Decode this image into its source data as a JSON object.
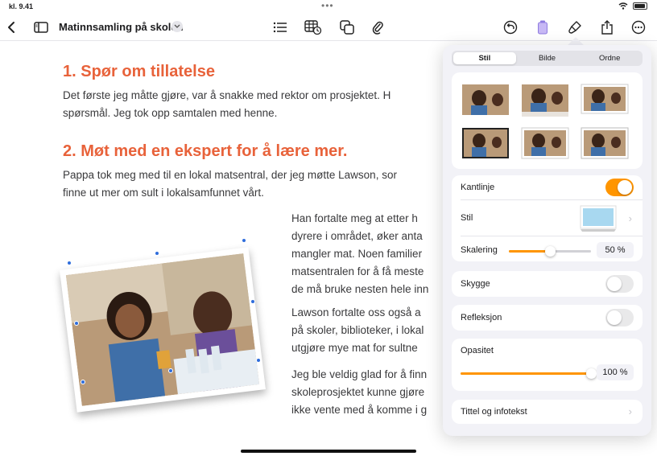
{
  "status": {
    "time": "kl. 9.41",
    "dots": "•••"
  },
  "toolbar": {
    "title": "Matinnsamling på skolen",
    "icons": [
      "back-icon",
      "sidebar-icon",
      "title-chevron-icon",
      "list-icon",
      "table-icon",
      "shapes-icon",
      "attachment-icon",
      "undo-icon",
      "document-icon",
      "format-brush-icon",
      "share-icon",
      "more-icon"
    ]
  },
  "document": {
    "heading1": "1.   Spør om tillatelse",
    "para1": [
      "Det første jeg måtte gjøre, var å snakke med rektor om prosjektet. H",
      "spørsmål. Jeg tok opp samtalen med henne."
    ],
    "heading2": "2.   Møt med en ekspert for å lære mer.",
    "para2": [
      "Pappa tok meg med til en lokal matsentral, der jeg møtte Lawson, sor",
      "finne ut mer om sult i lokalsamfunnet vårt."
    ],
    "para3": [
      "Han fortalte meg at etter h",
      "dyrere i området, øker anta",
      "mangler mat. Noen familier",
      "matsentralen for å få meste",
      "de må bruke nesten hele inn"
    ],
    "para4": [
      " Lawson fortalte oss også a",
      "på skoler, biblioteker, i lokal",
      "utgjøre mye mat for sultne"
    ],
    "para5": [
      "Jeg ble veldig glad for å finn",
      "skoleprosjektet kunne gjøre",
      "ikke vente med å komme i g"
    ]
  },
  "popover": {
    "tabs": [
      {
        "label": "Stil",
        "active": true
      },
      {
        "label": "Bilde",
        "active": false
      },
      {
        "label": "Ordne",
        "active": false
      }
    ],
    "border": {
      "label": "Kantlinje",
      "on": true
    },
    "style": {
      "label": "Stil"
    },
    "scale": {
      "label": "Skalering",
      "value": "50 %",
      "fraction": 0.5
    },
    "shadow": {
      "label": "Skygge",
      "on": false
    },
    "reflection": {
      "label": "Refleksjon",
      "on": false
    },
    "opacity": {
      "label": "Opasitet",
      "value": "100 %",
      "fraction": 1.0
    },
    "caption": {
      "label": "Tittel og infotekst"
    }
  },
  "colors": {
    "accent": "#ff9500",
    "heading": "#e8623a",
    "handle": "#2f6ddc",
    "tint": "#5e5ce6"
  }
}
